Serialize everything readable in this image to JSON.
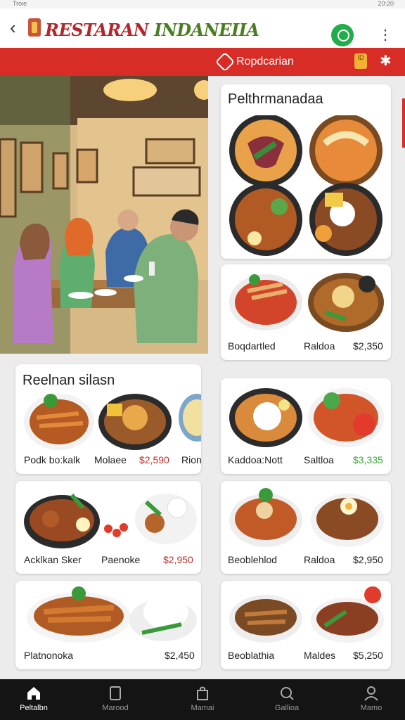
{
  "status": {
    "left": "Troie",
    "right": "20:20"
  },
  "header": {
    "title_part1": "RESTARAN",
    "title_part2": "INDANEIIA"
  },
  "subbar": {
    "label": "Ropdcarian",
    "badge": "ID"
  },
  "cards": {
    "featured": {
      "title": "Pelthrmanadaa"
    },
    "featured_row": {
      "name": "Boqdartled",
      "tag": "Raldoa",
      "price": "$2,350"
    },
    "recommend": {
      "title": "Reelnan silasn",
      "items": [
        {
          "name": "Podk bo:kalk",
          "tag": "Molaee",
          "price": "$2,590",
          "extra": "Rion"
        }
      ]
    },
    "right1": {
      "name": "Kaddoa:Nott",
      "tag": "Saltloa",
      "price": "$3,335"
    },
    "left2": {
      "name": "Acklkan Sker",
      "tag": "Paenoke",
      "price": "$2,950"
    },
    "right2": {
      "name": "Beoblehlod",
      "tag": "Raldoa",
      "price": "$2,950"
    },
    "left3": {
      "name": "Platnonoka",
      "price": "$2,450"
    },
    "right3": {
      "name": "Beoblathia",
      "tag": "Maldes",
      "price": "$5,250"
    }
  },
  "nav": [
    {
      "label": "Peltalbn",
      "icon": "home-icon",
      "active": true
    },
    {
      "label": "Marood",
      "icon": "book-icon",
      "active": false
    },
    {
      "label": "Mamai",
      "icon": "bag-icon",
      "active": false
    },
    {
      "label": "Gallioa",
      "icon": "search-icon",
      "active": false
    },
    {
      "label": "Mamo",
      "icon": "user-icon",
      "active": false
    }
  ],
  "colors": {
    "brand_red": "#d82d27",
    "green": "#1fae4a",
    "price_red": "#c0302b",
    "price_green": "#3aa935"
  }
}
